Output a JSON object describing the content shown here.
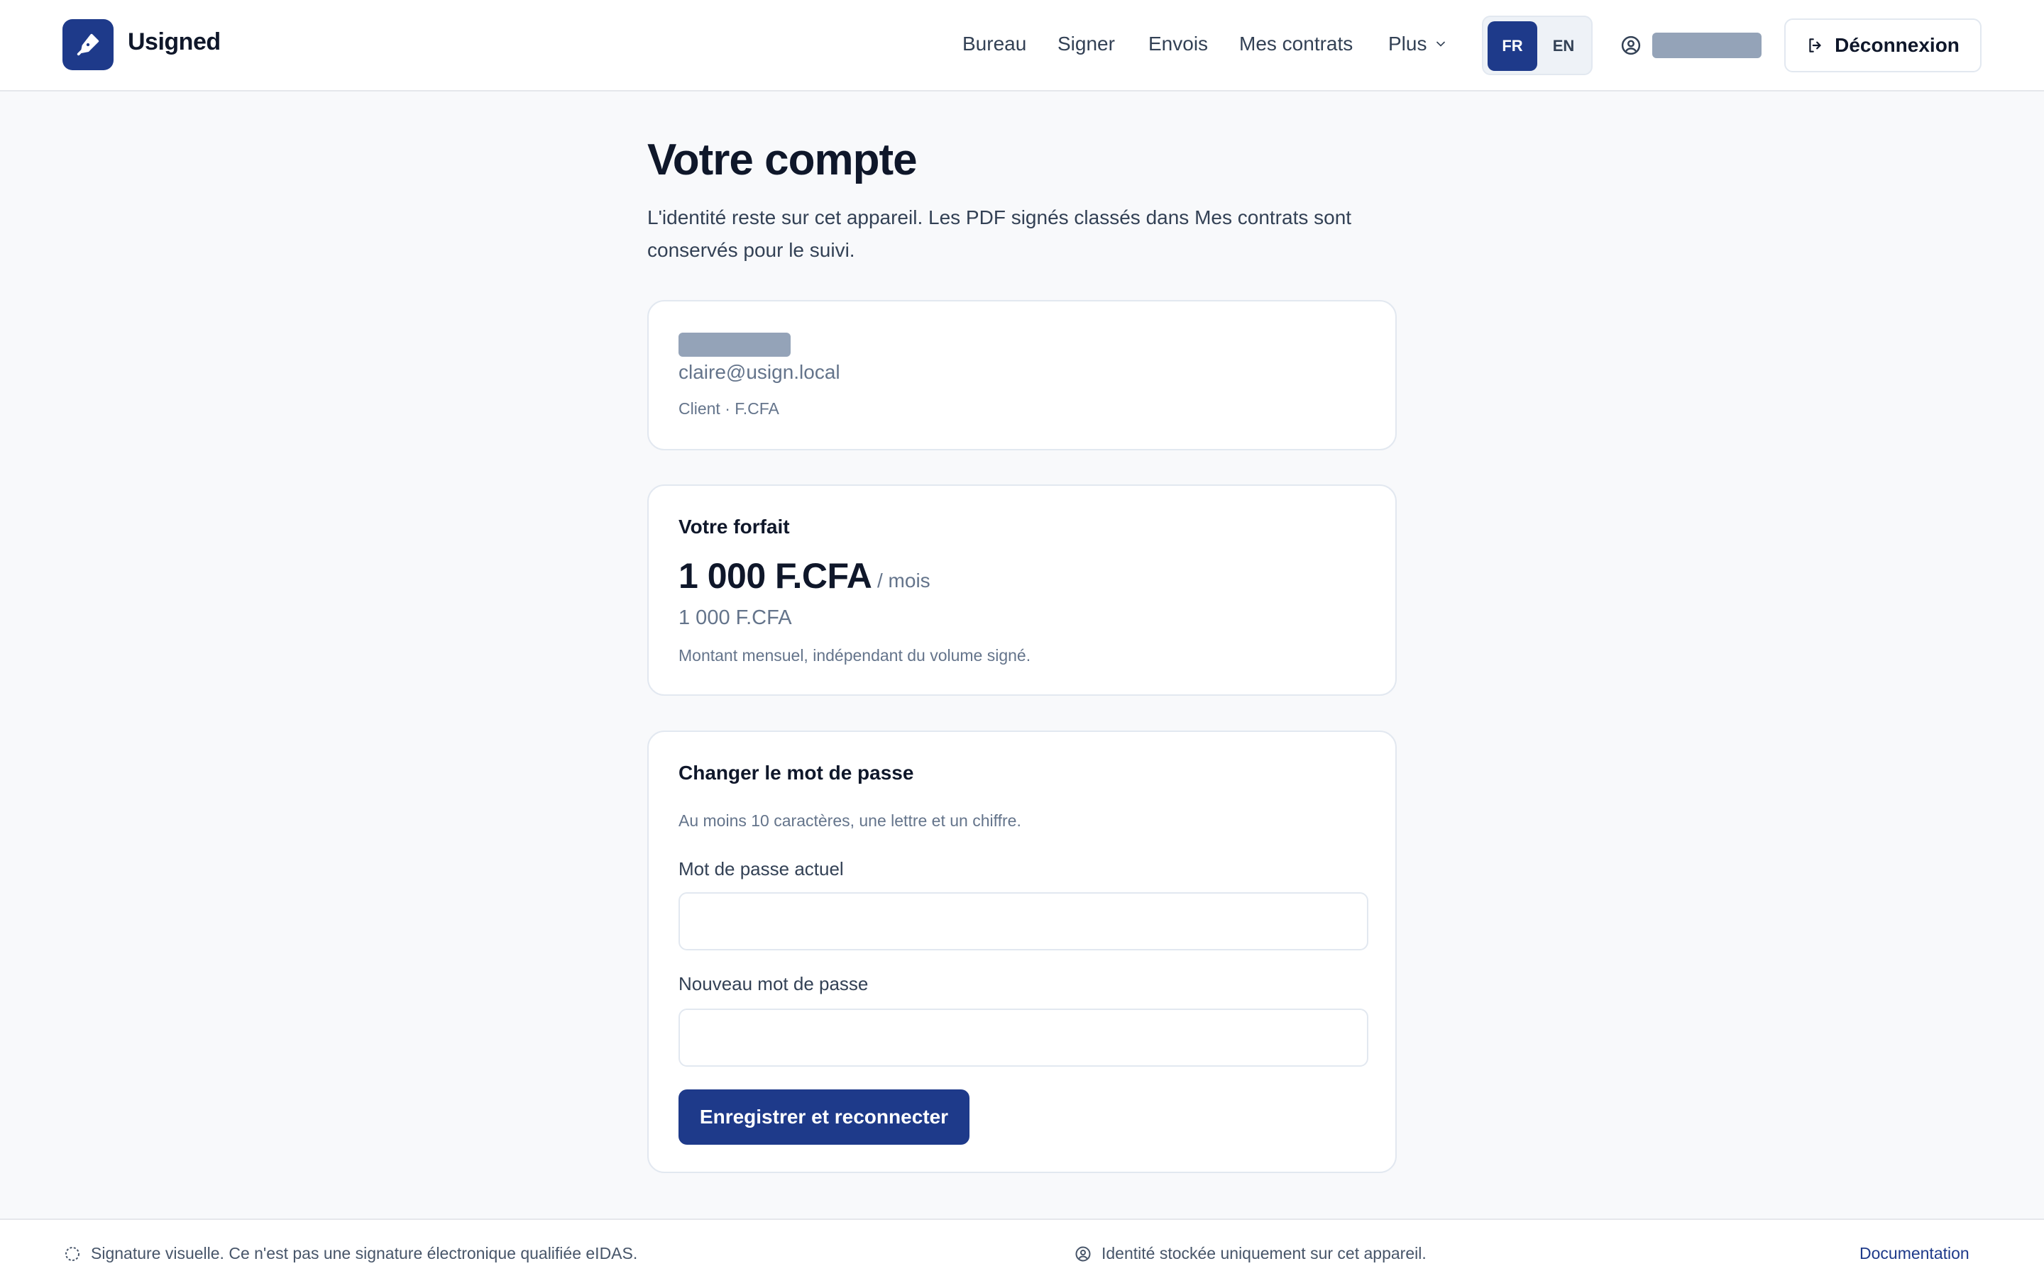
{
  "header": {
    "brand": "Usigned",
    "nav": [
      "Bureau",
      "Signer",
      "Envois",
      "Mes contrats"
    ],
    "more_label": "Plus",
    "lang": {
      "fr": "FR",
      "en": "EN",
      "active": "FR"
    },
    "logout_label": "Déconnexion"
  },
  "main": {
    "title": "Votre compte",
    "description": "L'identité reste sur cet appareil. Les PDF signés classés dans Mes contrats sont conservés pour le suivi.",
    "identity": {
      "email": "claire@usign.local",
      "role": "Client · F.CFA"
    },
    "plan": {
      "heading": "Votre forfait",
      "price": "1 000 F.CFA",
      "period": "/ mois",
      "sub_price": "1 000 F.CFA",
      "note": "Montant mensuel, indépendant du volume signé."
    },
    "password": {
      "heading": "Changer le mot de passe",
      "hint": "Au moins 10 caractères, une lettre et un chiffre.",
      "current_label": "Mot de passe actuel",
      "current_value": "",
      "new_label": "Nouveau mot de passe",
      "new_value": "",
      "submit_label": "Enregistrer et reconnecter"
    }
  },
  "footer": {
    "left_text": "Signature visuelle. Ce n'est pas une signature électronique qualifiée eIDAS.",
    "center_text": "Identité stockée uniquement sur cet appareil.",
    "doc_link": "Documentation"
  },
  "colors": {
    "primary": "#1e3a8a",
    "background": "#f8f9fb",
    "redacted": "#94a3b8"
  }
}
